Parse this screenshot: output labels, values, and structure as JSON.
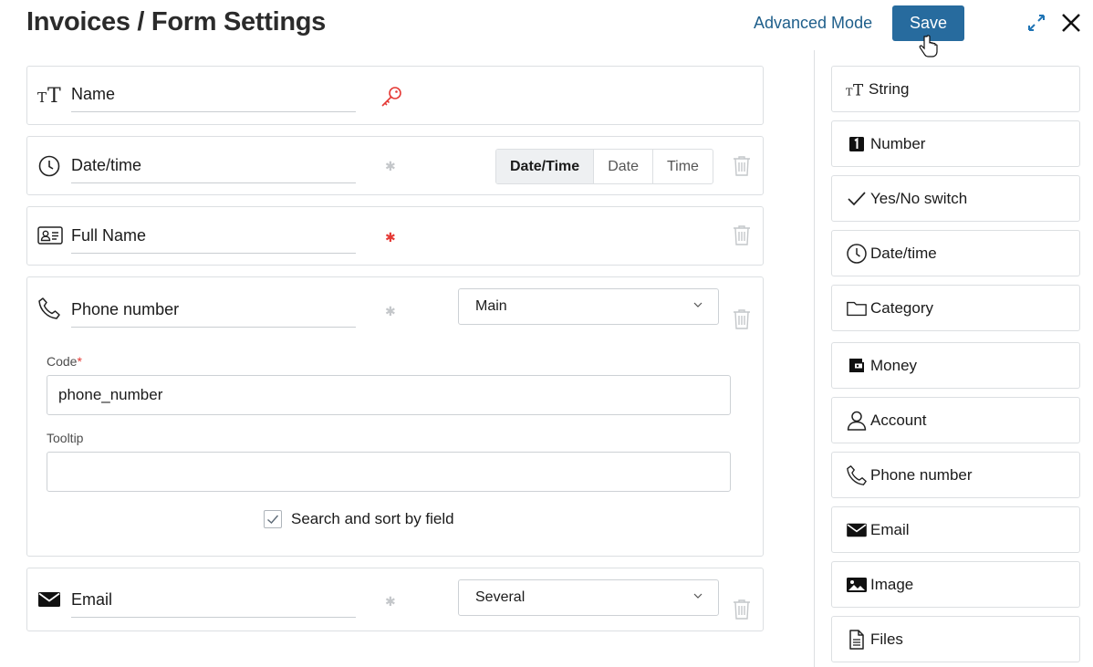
{
  "header": {
    "title": "Invoices / Form Settings",
    "advanced_mode": "Advanced Mode",
    "save_label": "Save"
  },
  "fields": {
    "name": {
      "label": "Name"
    },
    "datetime": {
      "label": "Date/time",
      "modes": [
        "Date/Time",
        "Date",
        "Time"
      ],
      "active_mode": "Date/Time"
    },
    "fullname": {
      "label": "Full Name"
    },
    "phone": {
      "label": "Phone number",
      "select_value": "Main",
      "code_label": "Code",
      "code_value": "phone_number",
      "tooltip_label": "Tooltip",
      "tooltip_value": "",
      "search_sort_label": "Search and sort by field",
      "search_sort_checked": true
    },
    "email": {
      "label": "Email",
      "select_value": "Several"
    }
  },
  "palette": [
    {
      "label": "String",
      "icon": "string-type-icon"
    },
    {
      "label": "Number",
      "icon": "number-icon"
    },
    {
      "label": "Yes/No switch",
      "icon": "check-icon"
    },
    {
      "label": "Date/time",
      "icon": "clock-icon"
    },
    {
      "label": "Category",
      "icon": "folder-icon"
    },
    {
      "label": "Money",
      "icon": "wallet-icon"
    },
    {
      "label": "Account",
      "icon": "user-icon"
    },
    {
      "label": "Phone number",
      "icon": "phone-icon"
    },
    {
      "label": "Email",
      "icon": "envelope-icon"
    },
    {
      "label": "Image",
      "icon": "image-icon"
    },
    {
      "label": "Files",
      "icon": "file-icon"
    }
  ],
  "colors": {
    "accent": "#276b9e",
    "link": "#1f5f8b",
    "required": "#e53935",
    "border": "#dcdfe2"
  }
}
